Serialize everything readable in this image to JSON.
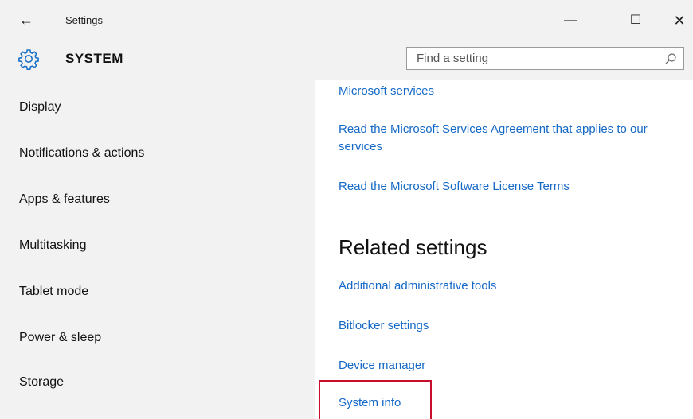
{
  "window": {
    "title": "Settings",
    "back_label": "←",
    "minimize_label": "—",
    "maximize_label": "☐",
    "close_label": "✕"
  },
  "header": {
    "app_title": "SYSTEM",
    "icon": "gear-icon",
    "search_placeholder": "Find a setting",
    "search_icon": "search-icon"
  },
  "sidebar": {
    "items": [
      {
        "label": "Display"
      },
      {
        "label": "Notifications & actions"
      },
      {
        "label": "Apps & features"
      },
      {
        "label": "Multitasking"
      },
      {
        "label": "Tablet mode"
      },
      {
        "label": "Power & sleep"
      },
      {
        "label": "Storage"
      }
    ]
  },
  "content": {
    "links_top": [
      {
        "label": "Microsoft services"
      },
      {
        "label": "Read the Microsoft Services Agreement that applies to our services"
      },
      {
        "label": "Read the Microsoft Software License Terms"
      }
    ],
    "related_heading": "Related settings",
    "related_links": [
      {
        "label": "Additional administrative tools"
      },
      {
        "label": "Bitlocker settings"
      },
      {
        "label": "Device manager"
      },
      {
        "label": "System info"
      }
    ]
  },
  "colors": {
    "accent": "#1569c7",
    "sidebar_bg": "#f2f2f2",
    "highlight_border": "#c8102e"
  }
}
